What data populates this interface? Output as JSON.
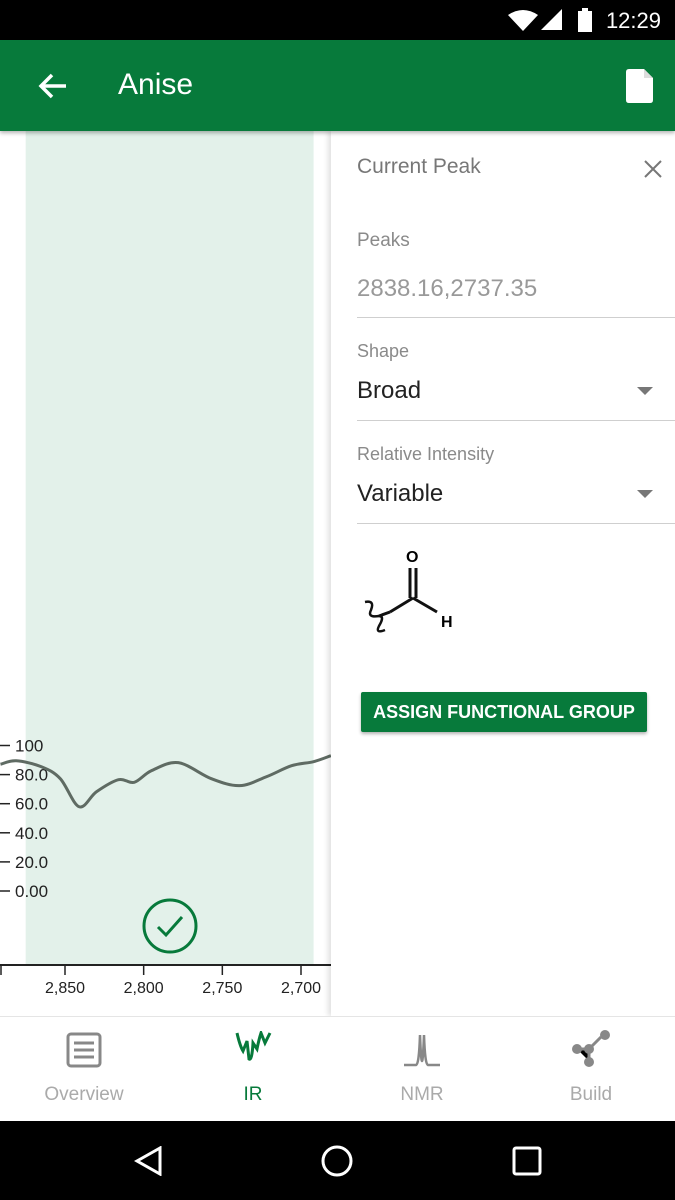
{
  "status_bar": {
    "time": "12:29"
  },
  "app_bar": {
    "title": "Anise",
    "back_icon": "arrow-left-icon",
    "action_icon": "document-icon"
  },
  "chart_data": {
    "type": "line",
    "xlim": [
      2891,
      2681
    ],
    "ylim": [
      -10,
      105
    ],
    "x_ticks": [
      "2,850",
      "2,800",
      "2,750",
      "2,700"
    ],
    "x_tick_values": [
      2850,
      2800,
      2750,
      2700
    ],
    "y_ticks": [
      "100",
      "80.0",
      "60.0",
      "40.0",
      "20.0",
      "0.00"
    ],
    "y_tick_values": [
      100,
      80,
      60,
      40,
      20,
      0
    ],
    "highlight_range": [
      2875,
      2692
    ],
    "highlight_color": "#e3f1ea",
    "line_color": "#5f6b63",
    "series": [
      {
        "x": [
          2891,
          2881,
          2865,
          2853,
          2841,
          2830,
          2816,
          2806,
          2795,
          2778,
          2757,
          2739,
          2722,
          2706,
          2692,
          2681
        ],
        "y": [
          87.1,
          89.5,
          85.4,
          77.2,
          57.9,
          68.2,
          76.5,
          74.7,
          82.7,
          88.2,
          77.2,
          72.4,
          78.5,
          86.1,
          88.9,
          93.0
        ]
      }
    ],
    "confirm_icon": "check-circle-icon"
  },
  "panel": {
    "header": "Current Peak",
    "peaks_label": "Peaks",
    "peaks_value": "2838.16,2737.35",
    "shape_label": "Shape",
    "shape_value": "Broad",
    "intensity_label": "Relative Intensity",
    "intensity_value": "Variable",
    "structure": {
      "atom_o": "O",
      "atom_h": "H"
    },
    "assign_button": "ASSIGN FUNCTIONAL GROUP"
  },
  "bottom_nav": [
    {
      "label": "Overview",
      "active": false
    },
    {
      "label": "IR",
      "active": true
    },
    {
      "label": "NMR",
      "active": false
    },
    {
      "label": "Build",
      "active": false
    }
  ],
  "colors": {
    "primary": "#077a3b",
    "inactive": "#aaaaaa"
  }
}
